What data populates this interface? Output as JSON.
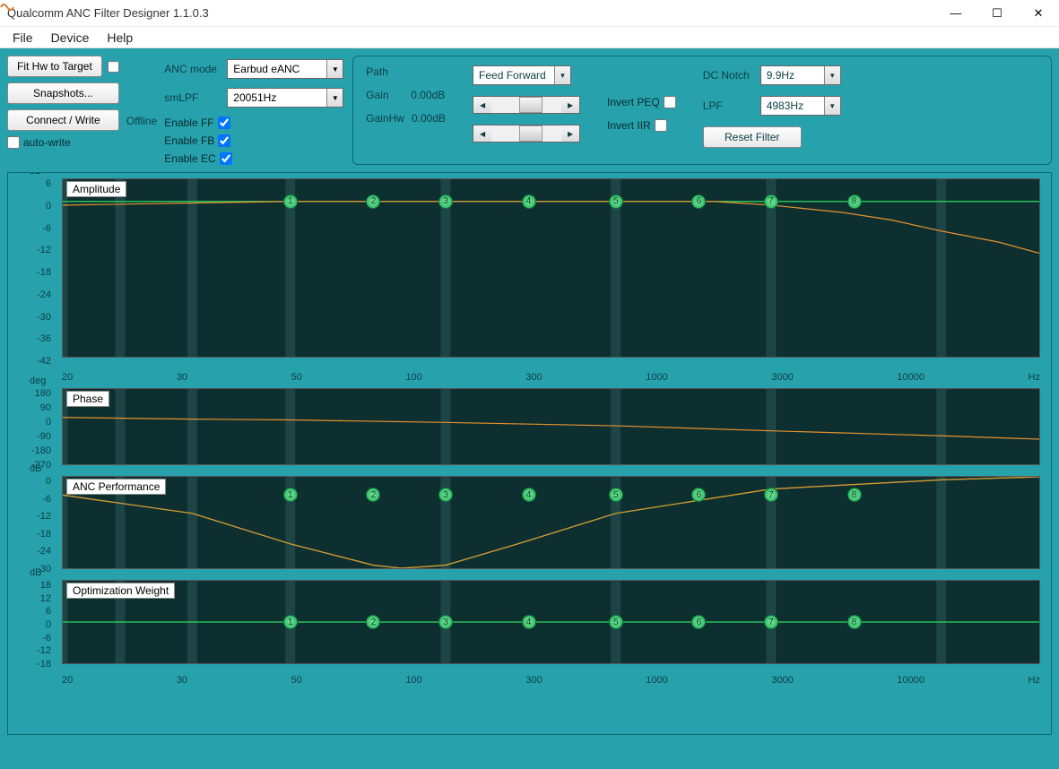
{
  "window": {
    "title": "Qualcomm ANC Filter Designer 1.1.0.3",
    "minimize": "—",
    "maximize": "☐",
    "close": "✕"
  },
  "menu": {
    "file": "File",
    "device": "Device",
    "help": "Help"
  },
  "buttons": {
    "fit": "Fit Hw to Target",
    "snapshots": "Snapshots...",
    "connect": "Connect / Write",
    "autowrite": "auto-write",
    "reset": "Reset Filter"
  },
  "status": {
    "offline": "Offline"
  },
  "mode": {
    "anc_label": "ANC mode",
    "anc_value": "Earbud eANC",
    "smlpf_label": "smLPF",
    "smlpf_value": "20051Hz",
    "enable_ff": "Enable FF",
    "enable_fb": "Enable FB",
    "enable_ec": "Enable EC"
  },
  "filter": {
    "path_label": "Path",
    "path_value": "Feed Forward",
    "gain_label": "Gain",
    "gain_value": "0.00dB",
    "gainhw_label": "GainHw",
    "gainhw_value": "0.00dB",
    "invert_peq": "Invert PEQ",
    "invert_iir": "Invert IIR",
    "dcnotch_label": "DC Notch",
    "dcnotch_value": "9.9Hz",
    "lpf_label": "LPF",
    "lpf_value": "4983Hz"
  },
  "charts": {
    "amplitude": {
      "title": "Amplitude",
      "unit": "dB",
      "ylabels": [
        "6",
        "0",
        "-6",
        "-12",
        "-18",
        "-24",
        "-30",
        "-36",
        "-42"
      ]
    },
    "phase": {
      "title": "Phase",
      "unit": "deg",
      "ylabels": [
        "180",
        "90",
        "0",
        "-90",
        "-180",
        "-270"
      ]
    },
    "anc": {
      "title": "ANC Performance",
      "unit": "dB",
      "ylabels": [
        "0",
        "-6",
        "-12",
        "-18",
        "-24",
        "-30"
      ]
    },
    "weight": {
      "title": "Optimization Weight",
      "unit": "dB",
      "ylabels": [
        "18",
        "12",
        "6",
        "0",
        "-6",
        "-12",
        "-18"
      ]
    },
    "xlabels": [
      "20",
      "30",
      "50",
      "100",
      "300",
      "1000",
      "3000",
      "10000"
    ],
    "xunit": "Hz",
    "markers": [
      "1",
      "2",
      "3",
      "4",
      "5",
      "6",
      "7",
      "8"
    ]
  },
  "chart_data": [
    {
      "type": "line",
      "title": "Amplitude",
      "xlabel": "Hz",
      "ylabel": "dB",
      "xscale": "log",
      "xlim": [
        20,
        20000
      ],
      "ylim": [
        -42,
        6
      ],
      "series": [
        {
          "name": "green",
          "x": [
            20,
            100,
            300,
            1000,
            3000,
            10000,
            20000
          ],
          "values": [
            0,
            0,
            0,
            0,
            0,
            0,
            0
          ]
        },
        {
          "name": "orange",
          "x": [
            20,
            100,
            300,
            1000,
            2000,
            3000,
            5000,
            7000,
            10000,
            15000,
            20000
          ],
          "values": [
            -1,
            0,
            0,
            0,
            0,
            -1,
            -3,
            -5,
            -8,
            -11,
            -14
          ]
        }
      ],
      "markers_x": [
        100,
        180,
        300,
        540,
        1000,
        1800,
        3000,
        5400
      ]
    },
    {
      "type": "line",
      "title": "Phase",
      "xlabel": "Hz",
      "ylabel": "deg",
      "xscale": "log",
      "xlim": [
        20,
        20000
      ],
      "ylim": [
        -270,
        180
      ],
      "series": [
        {
          "name": "orange",
          "x": [
            20,
            50,
            100,
            300,
            1000,
            3000,
            10000,
            20000
          ],
          "values": [
            10,
            0,
            -5,
            -20,
            -40,
            -70,
            -100,
            -120
          ]
        }
      ]
    },
    {
      "type": "line",
      "title": "ANC Performance",
      "xlabel": "Hz",
      "ylabel": "dB",
      "xscale": "log",
      "xlim": [
        20,
        20000
      ],
      "ylim": [
        -30,
        0
      ],
      "series": [
        {
          "name": "green",
          "x": [
            20,
            50,
            100,
            180,
            220,
            300,
            500,
            1000,
            3000,
            10000,
            20000
          ],
          "values": [
            -6,
            -12,
            -22,
            -29,
            -30,
            -29,
            -22,
            -12,
            -4,
            -1,
            0
          ]
        },
        {
          "name": "orange",
          "x": [
            20,
            50,
            100,
            180,
            220,
            300,
            500,
            1000,
            3000,
            10000,
            20000
          ],
          "values": [
            -6,
            -12,
            -22,
            -29,
            -30,
            -29,
            -22,
            -12,
            -4,
            -1,
            0
          ]
        }
      ],
      "markers_x": [
        100,
        180,
        300,
        540,
        1000,
        1800,
        3000,
        5400
      ]
    },
    {
      "type": "line",
      "title": "Optimization Weight",
      "xlabel": "Hz",
      "ylabel": "dB",
      "xscale": "log",
      "xlim": [
        20,
        20000
      ],
      "ylim": [
        -18,
        18
      ],
      "series": [
        {
          "name": "green",
          "x": [
            20,
            20000
          ],
          "values": [
            0,
            0
          ]
        }
      ],
      "markers_x": [
        100,
        180,
        300,
        540,
        1000,
        1800,
        3000,
        5400
      ]
    }
  ]
}
